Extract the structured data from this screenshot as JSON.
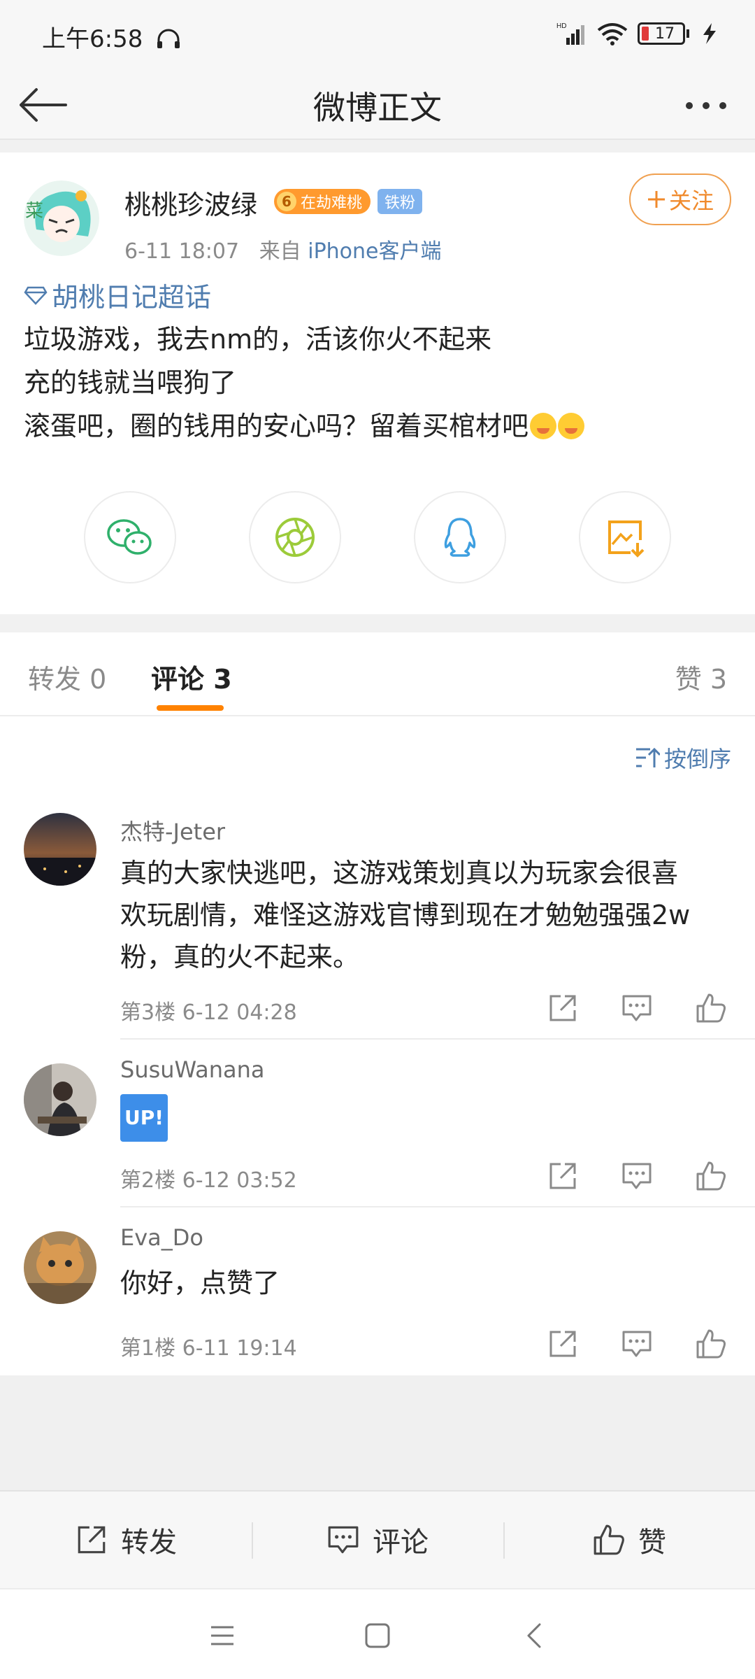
{
  "status_bar": {
    "time": "上午6:58",
    "battery": "17",
    "signal_label": "HD"
  },
  "nav": {
    "title": "微博正文"
  },
  "post": {
    "author": "桃桃珍波绿",
    "level_badge_num": "6",
    "level_badge_text": "在劫难桃",
    "fan_badge": "铁粉",
    "time": "6-11 18:07",
    "source_prefix": "来自",
    "source": "iPhone客户端",
    "follow_label": "关注",
    "topic": "胡桃日记超话",
    "lines": [
      "垃圾游戏，我去nm的，活该你火不起来",
      "充的钱就当喂狗了",
      "滚蛋吧，圈的钱用的安心吗？留着买棺材吧"
    ],
    "share_icons": [
      "wechat-icon",
      "moments-icon",
      "qq-icon",
      "save-image-icon"
    ]
  },
  "tabs": {
    "repost": "转发 0",
    "comment": "评论 3",
    "like": "赞 3"
  },
  "sort_label": "按倒序",
  "comments": [
    {
      "name": "杰特-Jeter",
      "lines": [
        "真的大家快逃吧，这游戏策划真以为玩家会很喜",
        "欢玩剧情，难怪这游戏官博到现在才勉勉强强2w",
        "粉，真的火不起来。"
      ],
      "meta": "第3楼 6-12 04:28"
    },
    {
      "name": "SusuWanana",
      "badge": "UP!",
      "meta": "第2楼 6-12 03:52"
    },
    {
      "name": "Eva_Do",
      "lines": [
        "你好，点赞了"
      ],
      "meta": "第1楼 6-11 19:14"
    }
  ],
  "action_bar": {
    "repost": "转发",
    "comment": "评论",
    "like": "赞"
  },
  "colors": {
    "orange": "#ff8200",
    "link_blue": "#507daf",
    "follow_orange": "#f08a2c"
  }
}
